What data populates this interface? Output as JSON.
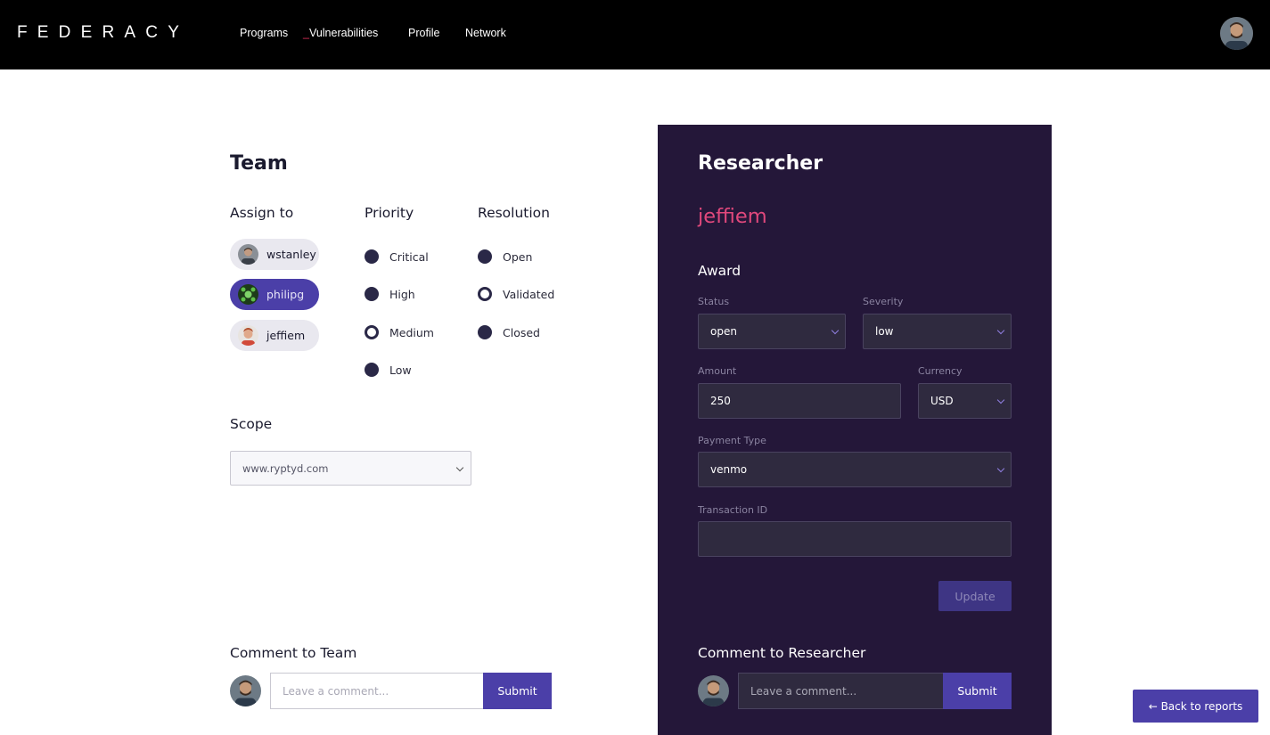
{
  "header": {
    "logo": "FEDERACY",
    "nav": [
      {
        "label": "Programs",
        "prefix": ""
      },
      {
        "label": "Vulnerabilities",
        "prefix": "_"
      },
      {
        "label": "Profile",
        "prefix": ""
      },
      {
        "label": "Network",
        "prefix": ""
      }
    ]
  },
  "team": {
    "title": "Team",
    "assign_title": "Assign to",
    "assignees": [
      {
        "name": "wstanley",
        "active": false
      },
      {
        "name": "philipg",
        "active": true
      },
      {
        "name": "jeffiem",
        "active": false
      }
    ],
    "priority_title": "Priority",
    "priorities": [
      {
        "label": "Critical",
        "selected": false
      },
      {
        "label": "High",
        "selected": false
      },
      {
        "label": "Medium",
        "selected": true
      },
      {
        "label": "Low",
        "selected": false
      }
    ],
    "resolution_title": "Resolution",
    "resolutions": [
      {
        "label": "Open",
        "selected": false
      },
      {
        "label": "Validated",
        "selected": true
      },
      {
        "label": "Closed",
        "selected": false
      }
    ],
    "scope_title": "Scope",
    "scope_value": "www.ryptyd.com",
    "comment_title": "Comment to Team",
    "comment_placeholder": "Leave a comment...",
    "submit_label": "Submit"
  },
  "researcher": {
    "title": "Researcher",
    "name": "jeffiem",
    "award_title": "Award",
    "status_label": "Status",
    "status_value": "open",
    "severity_label": "Severity",
    "severity_value": "low",
    "amount_label": "Amount",
    "amount_value": "250",
    "currency_label": "Currency",
    "currency_value": "USD",
    "payment_label": "Payment Type",
    "payment_value": "venmo",
    "transaction_label": "Transaction ID",
    "transaction_value": "",
    "update_label": "Update",
    "comment_title": "Comment to Researcher",
    "comment_placeholder": "Leave a comment...",
    "submit_label": "Submit"
  },
  "back_label": "← Back to reports",
  "colors": {
    "accent": "#4b3fa8",
    "panel": "#241739",
    "highlight": "#e0487c",
    "radio": "#2a2847"
  }
}
